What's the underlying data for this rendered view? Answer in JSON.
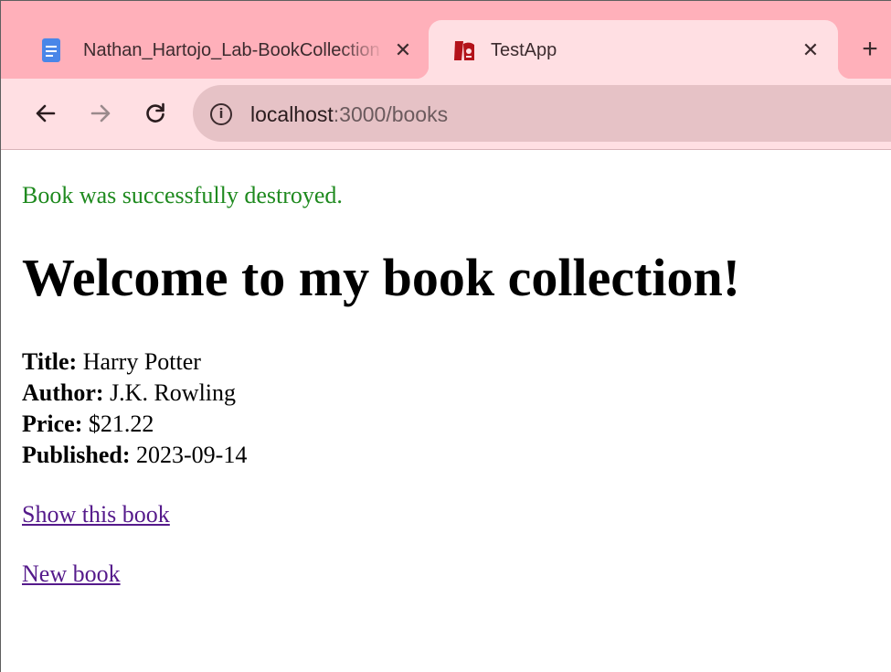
{
  "browser": {
    "tabs": [
      {
        "title": "Nathan_Hartojo_Lab-BookCollection",
        "favicon": "docs-icon",
        "close": "✕"
      },
      {
        "title": "TestApp",
        "favicon": "rails-icon",
        "close": "✕"
      }
    ],
    "new_tab": "+",
    "url": {
      "host": "localhost",
      "rest": ":3000/books"
    },
    "info_glyph": "i"
  },
  "page": {
    "notice": "Book was successfully destroyed.",
    "heading": "Welcome to my book collection!",
    "book": {
      "title_label": "Title:",
      "title": "Harry Potter",
      "author_label": "Author:",
      "author": "J.K. Rowling",
      "price_label": "Price:",
      "price": "$21.22",
      "published_label": "Published:",
      "published": "2023-09-14"
    },
    "show_link": "Show this book",
    "new_link": "New book"
  },
  "colors": {
    "tabstrip": "#ffb0ba",
    "toolbar": "#ffdfe3",
    "omnibox": "#e6c2c6",
    "notice": "#1f8a1f",
    "link": "#551a8b"
  }
}
